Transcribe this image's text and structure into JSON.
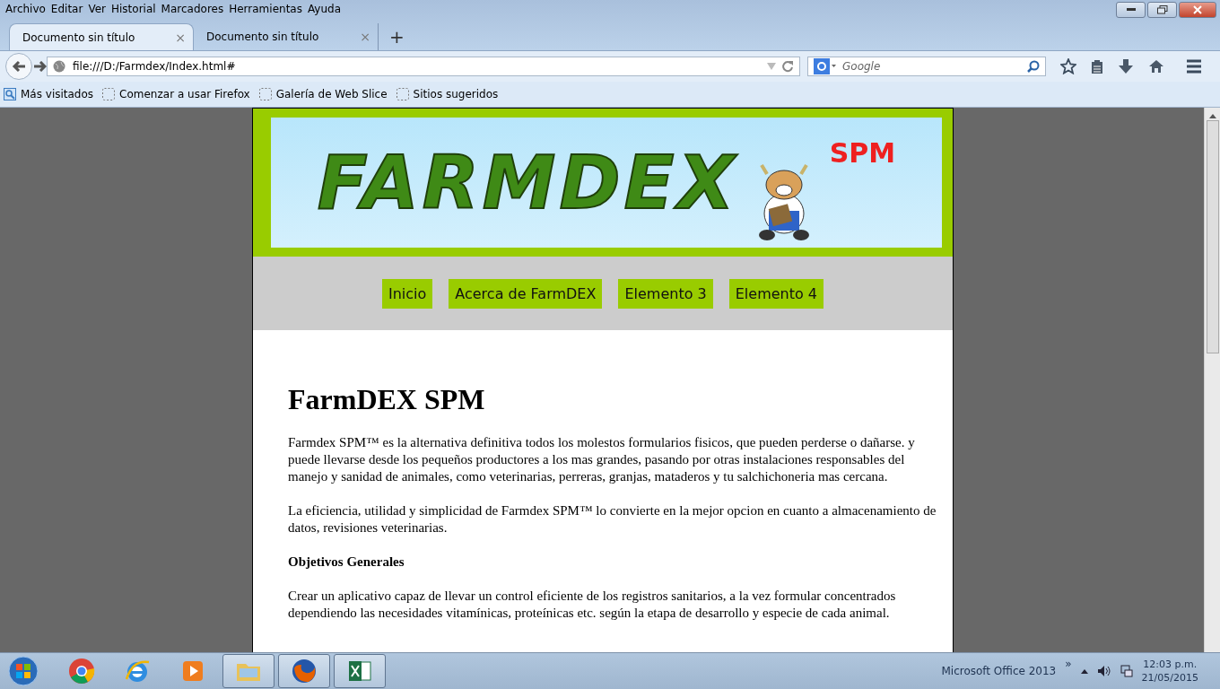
{
  "menu_bar": [
    "Archivo",
    "Editar",
    "Ver",
    "Historial",
    "Marcadores",
    "Herramientas",
    "Ayuda"
  ],
  "tabs": [
    {
      "title": "Documento sin título",
      "close": "×",
      "selected": true
    },
    {
      "title": "Documento sin título",
      "close": "×",
      "selected": false
    }
  ],
  "new_tab": "+",
  "address_bar": {
    "value": "file:///D:/Farmdex/Index.html#"
  },
  "search": {
    "placeholder": "Google"
  },
  "bookmarks": [
    {
      "label": "Más visitados",
      "kind": "folder"
    },
    {
      "label": "Comenzar a usar Firefox",
      "kind": "page"
    },
    {
      "label": "Galería de Web Slice",
      "kind": "page"
    },
    {
      "label": "Sitios sugeridos",
      "kind": "page"
    }
  ],
  "page": {
    "banner": {
      "logo": "FARMDEX",
      "badge": "SPM"
    },
    "nav": [
      "Inicio",
      "Acerca de FarmDEX",
      "Elemento 3",
      "Elemento 4"
    ],
    "heading": "FarmDEX SPM",
    "blocks": [
      {
        "kind": "p",
        "text": "Farmdex SPM™ es la alternativa definitiva todos los molestos formularios fisicos, que pueden perderse o dañarse. y puede llevarse desde los pequeños productores a los mas grandes, pasando por otras instalaciones responsables del manejo y sanidad de animales, como veterinarias, perreras, granjas, mataderos y tu salchichoneria mas cercana."
      },
      {
        "kind": "p",
        "text": "La eficiencia, utilidad y simplicidad de Farmdex SPM™ lo convierte en la mejor opcion en cuanto a almacenamiento de datos, revisiones veterinarias."
      },
      {
        "kind": "h",
        "text": "Objetivos Generales"
      },
      {
        "kind": "p",
        "text": "Crear un aplicativo capaz de llevar un control eficiente de los registros sanitarios, a la vez formular concentrados dependiendo las necesidades vitamínicas, proteínicas etc. según la etapa de desarrollo y especie de cada animal."
      }
    ]
  },
  "taskbar": {
    "apps": [
      {
        "kind": "chrome",
        "open": false
      },
      {
        "kind": "ie",
        "open": false
      },
      {
        "kind": "media",
        "open": false
      },
      {
        "kind": "explorer",
        "open": true
      },
      {
        "kind": "firefox",
        "open": true
      },
      {
        "kind": "excel",
        "open": true
      }
    ],
    "tray_label": "Microsoft Office 2013",
    "tray_more": "»",
    "time": "12:03 p.m.",
    "date": "21/05/2015"
  }
}
